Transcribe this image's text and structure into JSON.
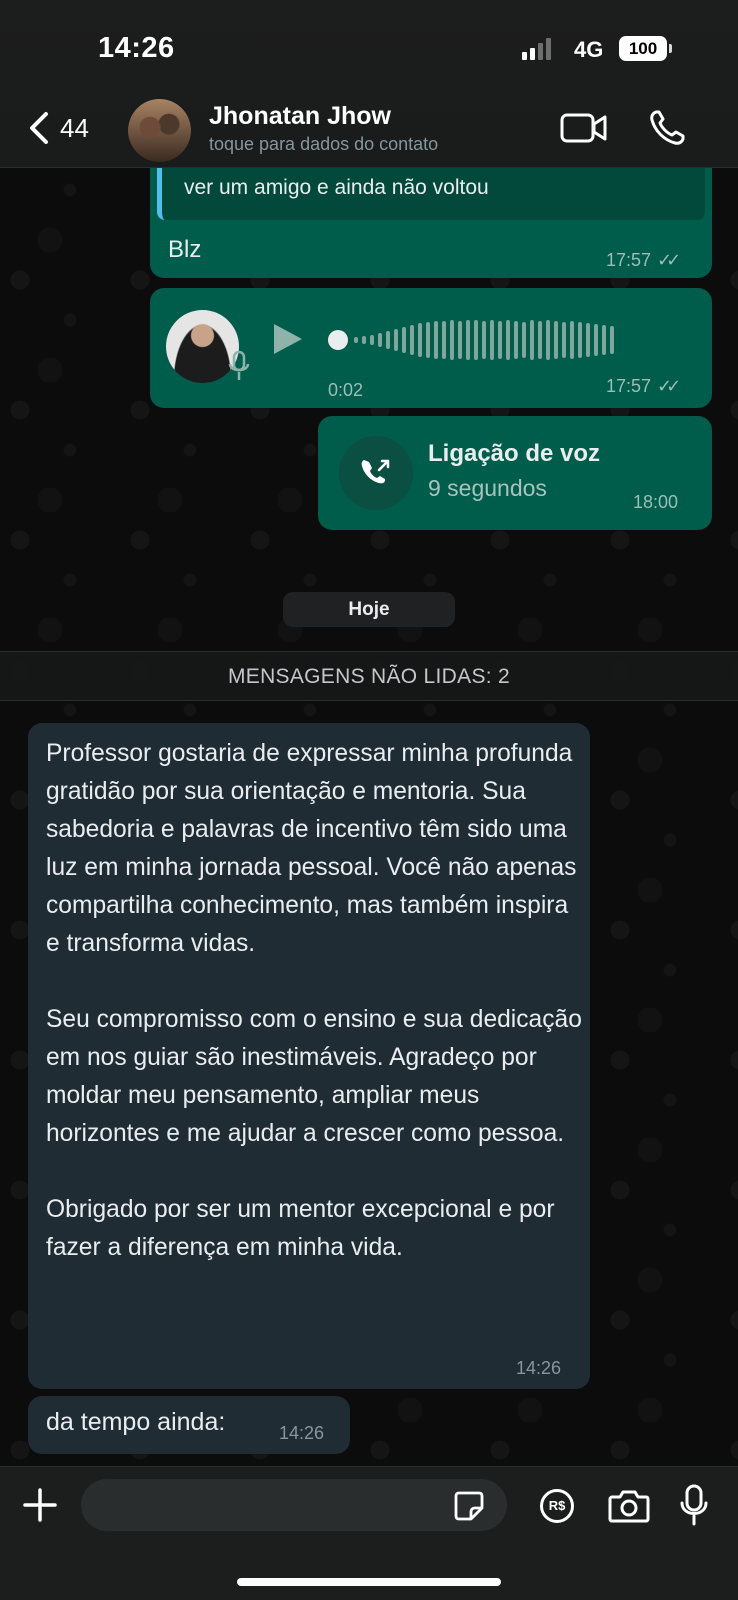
{
  "status_bar": {
    "time": "14:26",
    "network": "4G",
    "battery": "100"
  },
  "header": {
    "back_count": "44",
    "contact_name": "Jhonatan Jhow",
    "contact_subtitle": "toque para dados do contato"
  },
  "messages": {
    "quoted_text": "ver um amigo e ainda não voltou",
    "reply_text": "Blz",
    "reply_time": "17:57",
    "audio_duration": "0:02",
    "audio_time": "17:57",
    "call_title": "Ligação de voz",
    "call_duration": "9 segundos",
    "call_time": "18:00"
  },
  "date_chip": "Hoje",
  "unread_banner": "MENSAGENS NÃO LIDAS: 2",
  "incoming": {
    "long_text": "Professor gostaria de expressar minha profunda gratidão por sua orientação e mentoria. Sua sabedoria e palavras de incentivo têm sido uma luz em minha jornada pessoal. Você não apenas compartilha conhecimento, mas também inspira e transforma vidas.\n\nSeu compromisso com o ensino e sua dedicação em nos guiar são inestimáveis. Agradeço por moldar meu pensamento, ampliar meus horizontes e me ajudar a crescer como pessoa.\n\nObrigado por ser um mentor excepcional e por fazer a diferença em minha vida.",
    "long_time": "14:26",
    "short_text": "da tempo ainda:",
    "short_time": "14:26"
  },
  "input_bar": {
    "pay_label": "R$"
  },
  "colors": {
    "outgoing_bubble": "#005c4b",
    "incoming_bubble": "#202c33",
    "quote_accent": "#53bdeb"
  }
}
